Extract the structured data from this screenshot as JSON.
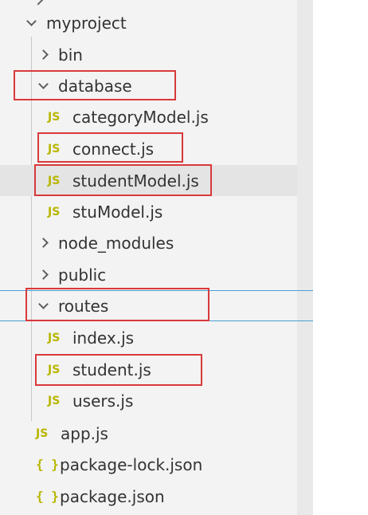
{
  "tree": {
    "root": {
      "label": "myproject",
      "expanded": true
    },
    "bin": {
      "label": "bin",
      "expanded": false
    },
    "database": {
      "label": "database",
      "expanded": true,
      "files": [
        {
          "label": "categoryModel.js",
          "icon": "JS"
        },
        {
          "label": "connect.js",
          "icon": "JS"
        },
        {
          "label": "studentModel.js",
          "icon": "JS"
        },
        {
          "label": "stuModel.js",
          "icon": "JS"
        }
      ]
    },
    "node_modules": {
      "label": "node_modules",
      "expanded": false
    },
    "public": {
      "label": "public",
      "expanded": false
    },
    "routes": {
      "label": "routes",
      "expanded": true,
      "files": [
        {
          "label": "index.js",
          "icon": "JS"
        },
        {
          "label": "student.js",
          "icon": "JS"
        },
        {
          "label": "users.js",
          "icon": "JS"
        }
      ]
    },
    "root_files": [
      {
        "label": "app.js",
        "icon": "JS"
      },
      {
        "label": "package-lock.json",
        "icon": "{ }"
      },
      {
        "label": "package.json",
        "icon": "{ }"
      }
    ]
  },
  "colors": {
    "highlight_box": "#d9393a",
    "js_icon": "#b8b600",
    "focus_border": "#4a9fd6"
  }
}
